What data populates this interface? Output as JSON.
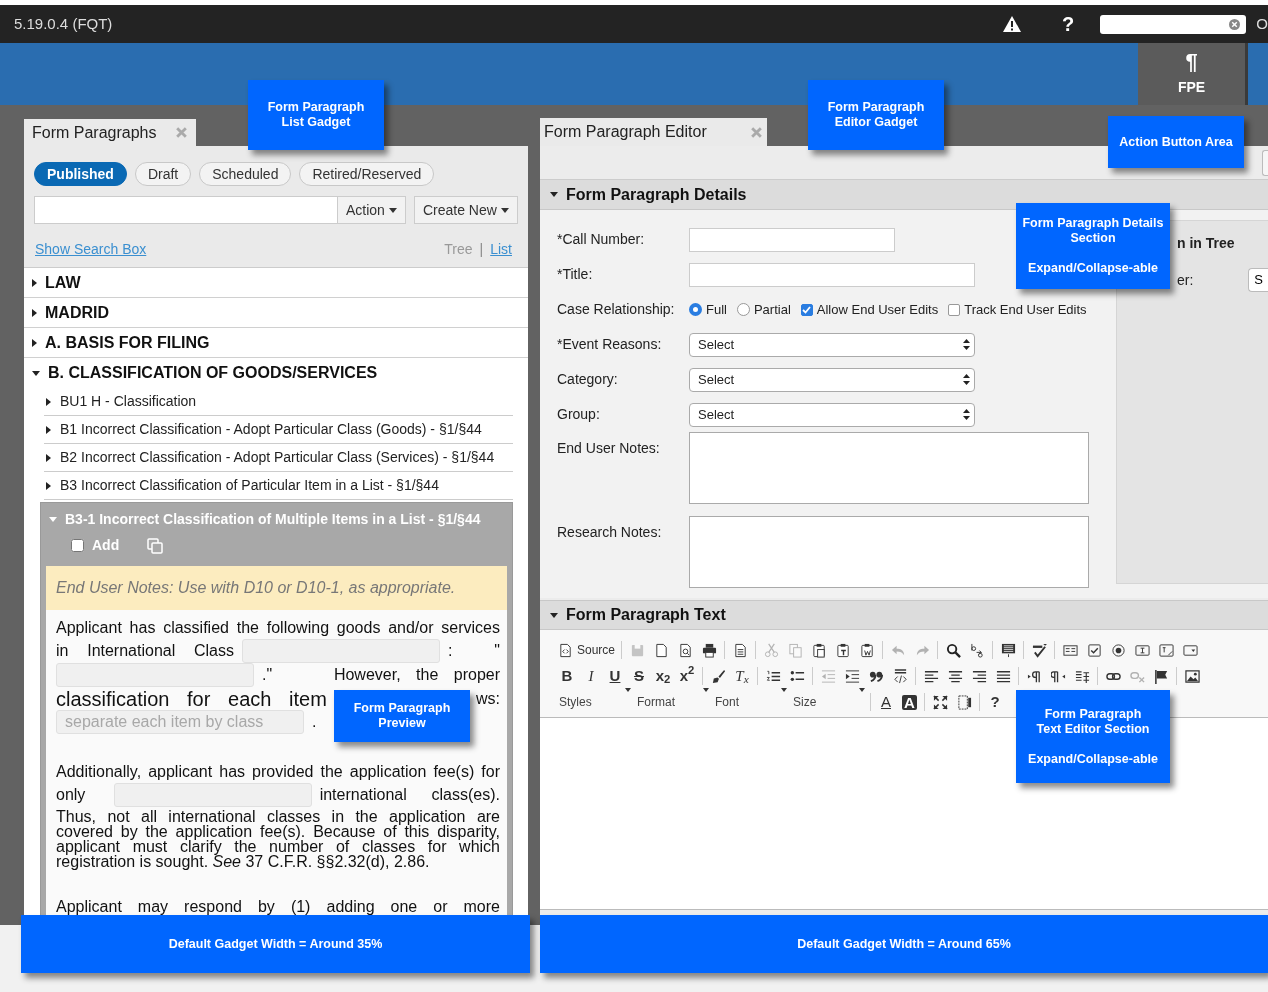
{
  "app_bar": {
    "version": "5.19.0.4 (FQT)",
    "help_glyph": "?",
    "edge_text": "O"
  },
  "ribbon": {
    "buttons": [
      {
        "glyph": "¶",
        "label": "FPE",
        "selected": true
      }
    ]
  },
  "list_gadget": {
    "tab": "Form Paragraphs",
    "status_filters": [
      {
        "label": "Published",
        "selected": true
      },
      {
        "label": "Draft",
        "selected": false
      },
      {
        "label": "Scheduled",
        "selected": false
      },
      {
        "label": "Retired/Reserved",
        "selected": false
      }
    ],
    "action_menu": "Action",
    "create_menu": "Create New",
    "show_search": "Show Search Box",
    "views": [
      {
        "label": "Tree",
        "selected": true
      },
      {
        "label": "List",
        "selected": false
      }
    ],
    "views_separator": "|",
    "tree": [
      {
        "label": "LAW",
        "expanded": false
      },
      {
        "label": "MADRID",
        "expanded": false
      },
      {
        "label": "A. BASIS FOR FILING",
        "expanded": false
      },
      {
        "label": "B. CLASSIFICATION OF GOODS/SERVICES",
        "expanded": true,
        "children": [
          {
            "label": "BU1 H - Classification",
            "expanded": false
          },
          {
            "label": "B1 Incorrect Classification - Adopt Particular Class (Goods) - §1/§44",
            "expanded": false
          },
          {
            "label": "B2 Incorrect Classification - Adopt Particular Class (Services) - §1/§44",
            "expanded": false
          },
          {
            "label": "B3 Incorrect Classification of Particular Item in a List - §1/§44",
            "expanded": false
          },
          {
            "label": "B3-1 Incorrect Classification of Multiple Items in a List - §1/§44",
            "expanded": true,
            "add_label": "Add",
            "add_checked": false,
            "preview": {
              "notes": "End User Notes: Use with D10 or D10-1, as appropriate.",
              "paragraphs": [
                [
                  [
                    {
                      "kind": "text",
                      "text": "Applicant has classified the following goods and/or services"
                    }
                  ],
                  [
                    {
                      "kind": "text",
                      "text": "in International Class"
                    },
                    {
                      "kind": "field"
                    },
                    {
                      "kind": "text",
                      "text": ":   \""
                    }
                  ],
                  [
                    {
                      "kind": "field"
                    },
                    {
                      "kind": "text",
                      "text": ".\"    However, the proper"
                    }
                  ],
                  [
                    {
                      "kind": "text",
                      "text": "classification for each item"
                    },
                    {
                      "kind": "text",
                      "text": "ws:"
                    }
                  ],
                  [
                    {
                      "kind": "field",
                      "placeholder": "separate each item by class"
                    },
                    {
                      "kind": "text",
                      "text": "."
                    }
                  ]
                ],
                [
                  [
                    {
                      "kind": "text",
                      "text": "Additionally, applicant has provided the application fee(s) for"
                    }
                  ],
                  [
                    {
                      "kind": "text",
                      "text": "only"
                    },
                    {
                      "kind": "field"
                    },
                    {
                      "kind": "text",
                      "text": "international class(es)."
                    }
                  ],
                  [
                    {
                      "kind": "block",
                      "text": "Thus, not all international classes in the application are covered by the application fee(s). Because of this disparity, applicant must clarify the number of classes for which registration is sought. *See* 37 C.F.R. §§2.32(d), 2.86."
                    }
                  ]
                ],
                [
                  [
                    {
                      "kind": "text",
                      "text": "Applicant may respond by (1) adding one or more"
                    }
                  ]
                ]
              ]
            }
          }
        ]
      }
    ]
  },
  "editor_gadget": {
    "tab": "Form Paragraph Editor",
    "details": {
      "title": "Form Paragraph Details",
      "expanded": true,
      "fields": [
        {
          "kind": "shortinput",
          "label": "*Call Number:"
        },
        {
          "kind": "input",
          "label": "*Title:"
        },
        {
          "kind": "options",
          "label": "Case Relationship:",
          "options": [
            {
              "kind": "radio",
              "label": "Full",
              "checked": true
            },
            {
              "kind": "radio",
              "label": "Partial",
              "checked": false
            },
            {
              "kind": "checkbox",
              "label": "Allow End User Edits",
              "checked": true
            },
            {
              "kind": "checkbox",
              "label": "Track End User Edits",
              "checked": false
            }
          ]
        },
        {
          "kind": "select",
          "label": "*Event Reasons:",
          "value": "Select"
        },
        {
          "kind": "select",
          "label": "Category:",
          "value": "Select"
        },
        {
          "kind": "select",
          "label": "Group:",
          "value": "Select"
        },
        {
          "kind": "textarea",
          "label": "End User Notes:"
        },
        {
          "kind": "textarea",
          "label": "Research Notes:"
        }
      ],
      "side_panel": {
        "heading": "n in Tree",
        "label": "er:",
        "button": "S"
      }
    },
    "text_section": {
      "title": "Form Paragraph Text",
      "expanded": true,
      "toolbar": [
        [
          {
            "kind": "source",
            "label": "Source"
          },
          {
            "kind": "sep"
          },
          {
            "kind": "save",
            "disabled": true
          },
          {
            "kind": "newpage"
          },
          {
            "kind": "preview"
          },
          {
            "kind": "print"
          },
          {
            "kind": "sep"
          },
          {
            "kind": "templates"
          },
          {
            "kind": "sep"
          },
          {
            "kind": "cut",
            "disabled": true
          },
          {
            "kind": "copy",
            "disabled": true
          },
          {
            "kind": "paste"
          },
          {
            "kind": "pastetext"
          },
          {
            "kind": "pasteword"
          },
          {
            "kind": "sep"
          },
          {
            "kind": "undo",
            "disabled": true
          },
          {
            "kind": "redo",
            "disabled": true
          },
          {
            "kind": "sep"
          },
          {
            "kind": "find"
          },
          {
            "kind": "replace"
          },
          {
            "kind": "sep"
          },
          {
            "kind": "selectall"
          },
          {
            "kind": "sep"
          },
          {
            "kind": "spell"
          },
          {
            "kind": "sep"
          },
          {
            "kind": "form"
          },
          {
            "kind": "checkbox"
          },
          {
            "kind": "radio"
          },
          {
            "kind": "textfield"
          },
          {
            "kind": "textarea"
          },
          {
            "kind": "select"
          }
        ],
        [
          {
            "kind": "bold",
            "text": "B"
          },
          {
            "kind": "italic",
            "text": "I"
          },
          {
            "kind": "underline",
            "text": "U"
          },
          {
            "kind": "strike",
            "text": "S"
          },
          {
            "kind": "subscript",
            "text": "x$_{2}$"
          },
          {
            "kind": "superscript",
            "text": "x$^{2}$"
          },
          {
            "kind": "sep"
          },
          {
            "kind": "brush"
          },
          {
            "kind": "removeformat",
            "text": "T$_{x}$"
          },
          {
            "kind": "sep"
          },
          {
            "kind": "numlist"
          },
          {
            "kind": "bullist"
          },
          {
            "kind": "sep"
          },
          {
            "kind": "outdent",
            "disabled": true
          },
          {
            "kind": "indent"
          },
          {
            "kind": "quote"
          },
          {
            "kind": "div"
          },
          {
            "kind": "sep"
          },
          {
            "kind": "alignleft"
          },
          {
            "kind": "aligncenter"
          },
          {
            "kind": "alignright"
          },
          {
            "kind": "justify"
          },
          {
            "kind": "sep"
          },
          {
            "kind": "ltr"
          },
          {
            "kind": "rtl"
          },
          {
            "kind": "language"
          },
          {
            "kind": "sep"
          },
          {
            "kind": "link"
          },
          {
            "kind": "unlink",
            "disabled": true
          },
          {
            "kind": "flag"
          },
          {
            "kind": "sep"
          },
          {
            "kind": "image"
          }
        ],
        [
          {
            "kind": "combo",
            "label": "Styles"
          },
          {
            "kind": "combo",
            "label": "Format"
          },
          {
            "kind": "combo",
            "label": "Font"
          },
          {
            "kind": "combo",
            "label": "Size"
          },
          {
            "kind": "sep"
          },
          {
            "kind": "textcolor",
            "text": "A"
          },
          {
            "kind": "bgcolor",
            "text": "A"
          },
          {
            "kind": "sep"
          },
          {
            "kind": "maximize"
          },
          {
            "kind": "blocks"
          },
          {
            "kind": "sep"
          },
          {
            "kind": "help",
            "text": "?"
          }
        ]
      ]
    }
  },
  "annotations": [
    {
      "blocks": [
        [
          "Form Paragraph",
          "List Gadget"
        ]
      ]
    },
    {
      "blocks": [
        [
          "Form Paragraph",
          "Editor Gadget"
        ]
      ]
    },
    {
      "blocks": [
        [
          "Action Button Area"
        ]
      ]
    },
    {
      "blocks": [
        [
          "Form Paragraph Details",
          "Section"
        ],
        [
          "Expand/Collapse-able"
        ]
      ]
    },
    {
      "blocks": [
        [
          "Form Paragraph",
          "Preview"
        ]
      ]
    },
    {
      "blocks": [
        [
          "Form Paragraph",
          "Text Editor Section"
        ],
        [
          "Expand/Collapse-able"
        ]
      ]
    },
    {
      "blocks": [
        [
          "Default Gadget Width = Around 35%"
        ]
      ]
    },
    {
      "blocks": [
        [
          "Default Gadget Width = Around 65%"
        ]
      ]
    }
  ]
}
